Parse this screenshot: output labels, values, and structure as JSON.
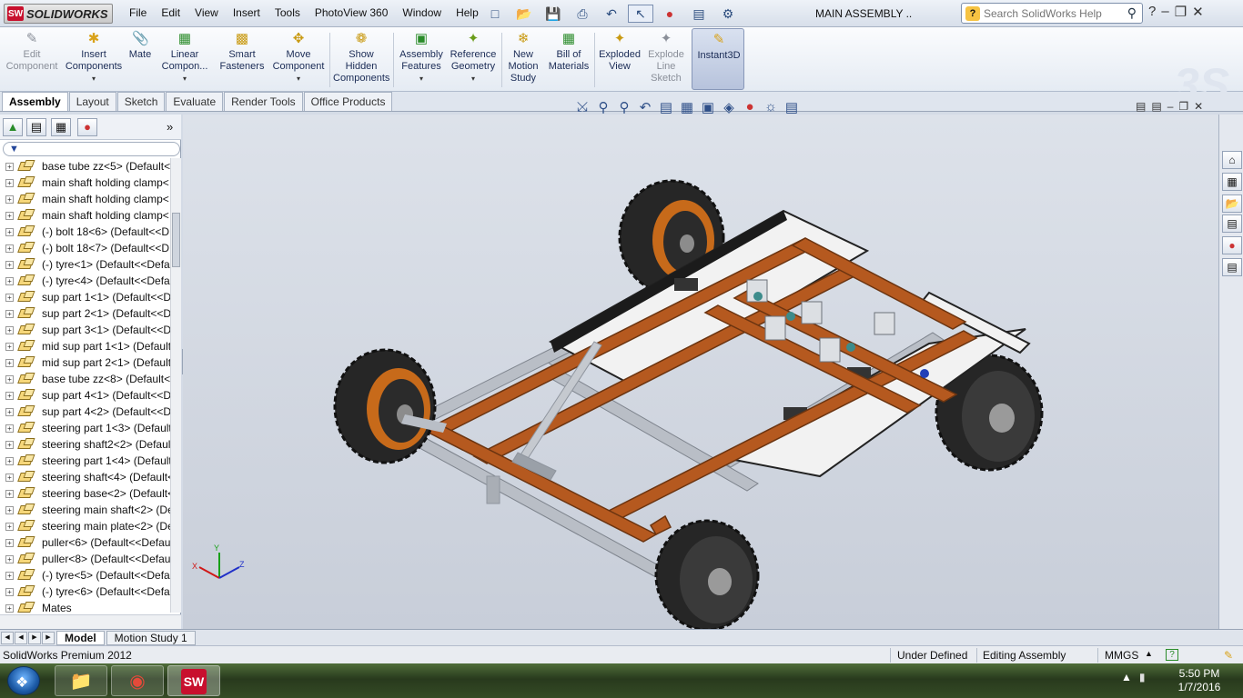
{
  "app": {
    "brand": "SOLIDWORKS",
    "doc_title": "MAIN ASSEMBLY .."
  },
  "menu": [
    "File",
    "Edit",
    "View",
    "Insert",
    "Tools",
    "PhotoView 360",
    "Window",
    "Help"
  ],
  "search": {
    "placeholder": "Search SolidWorks Help"
  },
  "ribbon": {
    "edit_component": "Edit\nComponent",
    "insert_components": "Insert\nComponents",
    "mate": "Mate",
    "linear_component": "Linear\nCompon...",
    "smart_fasteners": "Smart\nFasteners",
    "move_component": "Move\nComponent",
    "show_hidden": "Show\nHidden\nComponents",
    "assembly_features": "Assembly\nFeatures",
    "reference_geometry": "Reference\nGeometry",
    "new_motion_study": "New\nMotion\nStudy",
    "bill_of_materials": "Bill of\nMaterials",
    "exploded_view": "Exploded\nView",
    "explode_line_sketch": "Explode\nLine\nSketch",
    "instant3d": "Instant3D"
  },
  "tabs": [
    "Assembly",
    "Layout",
    "Sketch",
    "Evaluate",
    "Render Tools",
    "Office Products"
  ],
  "tree": [
    "base tube zz<5> (Default<<",
    "main shaft holding clamp<",
    "main shaft holding clamp<",
    "main shaft holding clamp<",
    "(-) bolt 18<6> (Default<<D",
    "(-) bolt 18<7> (Default<<D",
    "(-) tyre<1> (Default<<Defa",
    "(-) tyre<4> (Default<<Defa",
    "sup part 1<1> (Default<<D",
    "sup part 2<1> (Default<<D",
    "sup part 3<1> (Default<<D",
    "mid sup part 1<1> (Default",
    "mid sup part 2<1> (Default",
    "base tube zz<8> (Default<<",
    "sup part 4<1> (Default<<D",
    "sup part 4<2> (Default<<D",
    "steering part 1<3> (Default",
    "steering shaft2<2> (Default",
    "steering part 1<4> (Default",
    "steering shaft<4> (Default<",
    "steering base<2> (Default<",
    "steering main shaft<2> (De",
    "steering main plate<2> (De",
    "puller<6> (Default<<Defau",
    "puller<8> (Default<<Defau",
    "(-) tyre<5> (Default<<Defa",
    "(-) tyre<6> (Default<<Defa",
    "Mates"
  ],
  "model_tabs": [
    "Model",
    "Motion Study 1"
  ],
  "status": {
    "product": "SolidWorks Premium 2012",
    "state": "Under Defined",
    "mode": "Editing Assembly",
    "units": "MMGS"
  },
  "clock": {
    "time": "5:50 PM",
    "date": "1/7/2016"
  },
  "colors": {
    "wood": "#b5591f",
    "metal": "#b7bcc4",
    "tyre": "#2b2b2b",
    "hub": "#c76a1a"
  }
}
